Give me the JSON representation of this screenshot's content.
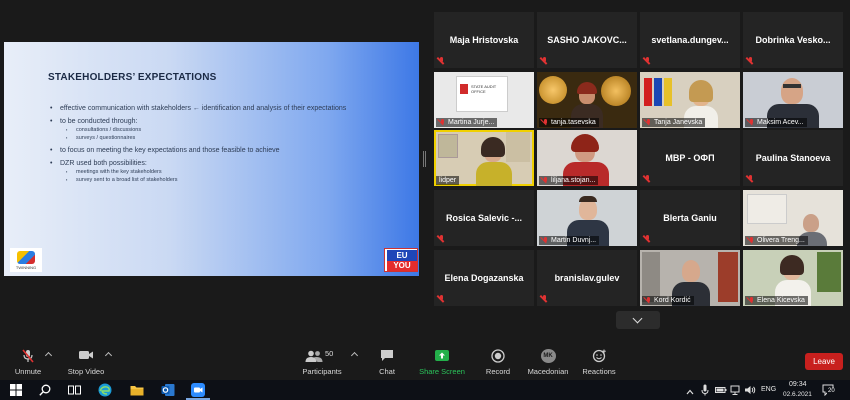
{
  "slide": {
    "title": "STAKEHOLDERS’ EXPECTATIONS",
    "bullets": [
      {
        "text": "effective communication with stakeholders ← identification and analysis of  their expectations",
        "sub": []
      },
      {
        "text": "to be conducted through:",
        "sub": [
          "consultations / discussions",
          "surveys / questionnaires"
        ]
      },
      {
        "text": "to focus on meeting the key expectations and those feasible to achieve",
        "sub": []
      },
      {
        "text": "DZR used both possibilities:",
        "sub": [
          "meetings with the key stakeholders",
          "survey sent to a broad list of stakeholders"
        ]
      }
    ],
    "logo_left_text": "TWINNING",
    "logo_right_top": "EU",
    "logo_right_bottom": "YOU"
  },
  "participants": [
    {
      "name": "Maja Hristovska",
      "video": false
    },
    {
      "name": "SASHO  JAKOVC...",
      "video": false
    },
    {
      "name": "svetlana.dungev...",
      "video": false
    },
    {
      "name": "Dobrinka  Vesko...",
      "video": false
    },
    {
      "name": "Martina Jurje...",
      "video": true,
      "sign": "STATE AUDIT OFFICE"
    },
    {
      "name": "tanja.tasevska",
      "video": true
    },
    {
      "name": "Tanja Janevska",
      "video": true
    },
    {
      "name": "Maksim Acev...",
      "video": true
    },
    {
      "name": "lidper",
      "video": true,
      "active": true
    },
    {
      "name": "liljana.stojan...",
      "video": true
    },
    {
      "name": "МВР - ОФП",
      "video": false
    },
    {
      "name": "Paulina Stanoeva",
      "video": false
    },
    {
      "name": "Rosica Salevic -...",
      "video": false
    },
    {
      "name": "Martin Duvnj...",
      "video": true
    },
    {
      "name": "Blerta Ganiu",
      "video": false
    },
    {
      "name": "Olivera Treng...",
      "video": true
    },
    {
      "name": "Elena Dogazanska",
      "video": false
    },
    {
      "name": "branislav.gulev",
      "video": false
    },
    {
      "name": "Kord Kordić",
      "video": true
    },
    {
      "name": "Elena Kicevska",
      "video": true
    }
  ],
  "toolbar": {
    "unmute": "Unmute",
    "stop_video": "Stop Video",
    "participants": "Participants",
    "participants_count": "50",
    "chat": "Chat",
    "share_screen": "Share Screen",
    "record": "Record",
    "language": "Macedonian",
    "language_badge": "MK",
    "reactions": "Reactions",
    "leave": "Leave"
  },
  "taskbar": {
    "lang": "ENG",
    "time": "09:34",
    "date": "02.6.2021",
    "notifications": "20"
  },
  "colors": {
    "leave": "#c8201e",
    "share_screen": "#23b04a",
    "muted_mic": "#e03232",
    "active_speaker": "#f0d000"
  }
}
